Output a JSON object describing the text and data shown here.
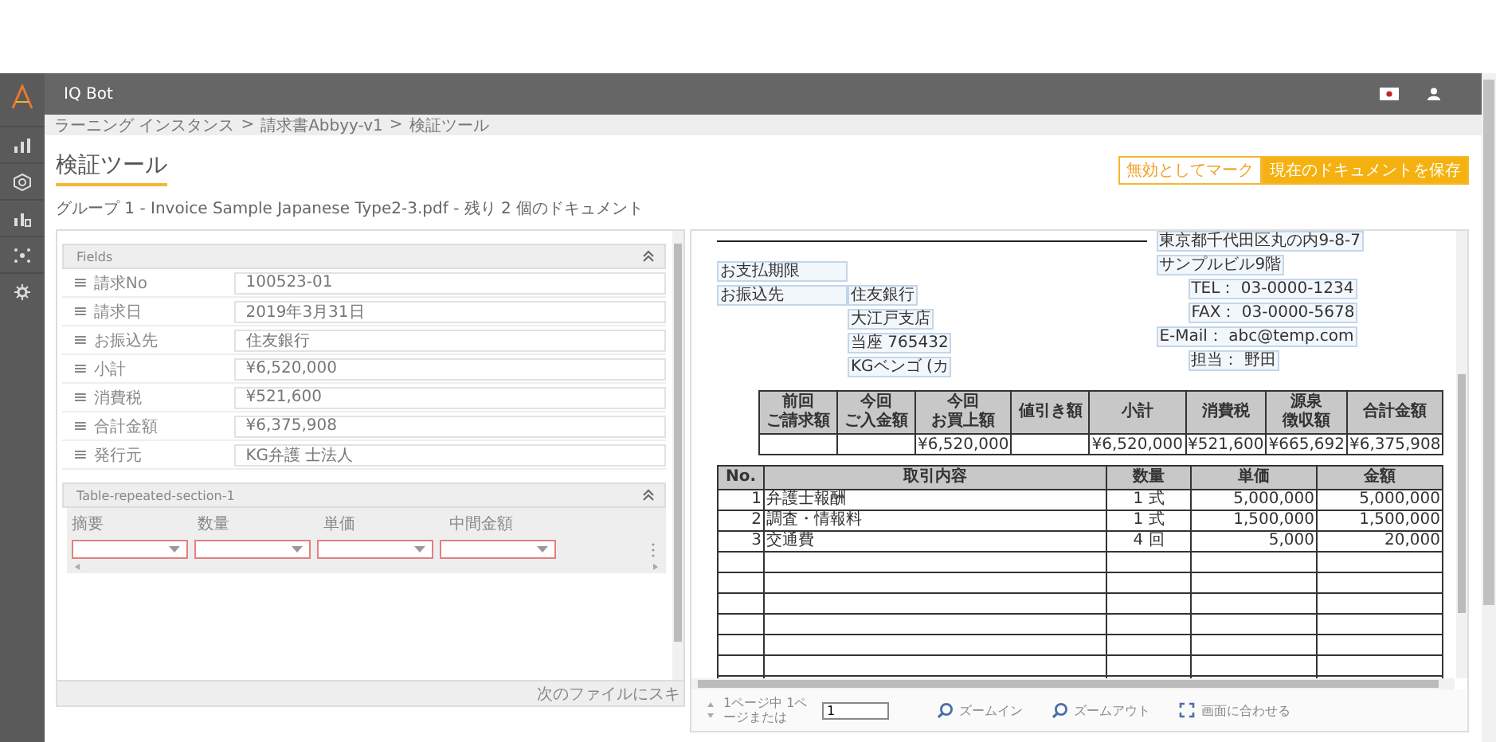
{
  "app": {
    "title": "IQ Bot"
  },
  "breadcrumb": {
    "separator": ">",
    "items": [
      "ラーニング インスタンス",
      "請求書Abbyy-v1",
      "検証ツール"
    ]
  },
  "page": {
    "title": "検証ツール",
    "subtitle": "グループ 1 - Invoice Sample Japanese Type2-3.pdf - 残り 2 個のドキュメント"
  },
  "actions": [
    {
      "label": "無効としてマーク",
      "kind": "outline"
    },
    {
      "label": "現在のドキュメントを保存",
      "kind": "primary"
    }
  ],
  "fields_panel": {
    "title": "Fields",
    "fields": [
      {
        "label": "請求No",
        "value": "100523-01"
      },
      {
        "label": "請求日",
        "value": "2019年3月31日"
      },
      {
        "label": "お振込先",
        "value": "住友銀行"
      },
      {
        "label": "小計",
        "value": "¥6,520,000"
      },
      {
        "label": "消費税",
        "value": "¥521,600"
      },
      {
        "label": "合計金額",
        "value": "¥6,375,908"
      },
      {
        "label": "発行元",
        "value": "KG弁護 士法人"
      }
    ]
  },
  "table_section": {
    "title": "Table-repeated-section-1",
    "columns": [
      {
        "label": "摘要",
        "invalid": true
      },
      {
        "label": "数量",
        "invalid": true
      },
      {
        "label": "単価",
        "invalid": true
      },
      {
        "label": "中間金額",
        "invalid": true
      }
    ]
  },
  "footer": {
    "skip_text": "次のファイルにスキ"
  },
  "viewer": {
    "document": {
      "sender_lines": [
        "東京都千代田区丸の内9-8-7",
        "サンプルビル9階",
        "TEL： 03-0000-1234",
        "FAX： 03-0000-5678",
        "E-Mail： abc@temp.com",
        "担当： 野田"
      ],
      "payment": [
        {
          "label": "お支払期限"
        },
        {
          "label": "お振込先",
          "lines": [
            "住友銀行",
            "大江戸支店",
            "当座 765432",
            "KGベンゴ (カ"
          ]
        }
      ],
      "summary": {
        "columns": [
          {
            "header": [
              "前回",
              "ご請求額"
            ]
          },
          {
            "header": [
              "今回",
              "ご入金額"
            ]
          },
          {
            "header": [
              "今回",
              "お買上額"
            ],
            "value": "¥6,520,000"
          },
          {
            "header": [
              "値引き額"
            ]
          },
          {
            "header": [
              "小計"
            ],
            "value": "¥6,520,000"
          },
          {
            "header": [
              "消費税"
            ],
            "value": "¥521,600"
          },
          {
            "header": [
              "源泉",
              "徴収額"
            ],
            "value": "¥665,692"
          },
          {
            "header": [
              "合計金額"
            ],
            "value": "¥6,375,908"
          }
        ]
      },
      "items": {
        "headers": [
          "No.",
          "取引内容",
          "数量",
          "単価",
          "金額"
        ],
        "rows": [
          [
            "1",
            "弁護士報酬",
            "1 式",
            "5,000,000",
            "5,000,000"
          ],
          [
            "2",
            "調査・情報料",
            "1 式",
            "1,500,000",
            "1,500,000"
          ],
          [
            "3",
            "交通費",
            "4 回",
            "5,000",
            "20,000"
          ]
        ]
      }
    },
    "pager": {
      "text": "1ページ中 1ページまたは",
      "page_value": "1"
    },
    "tools": [
      {
        "label": "ズームイン",
        "kind": "zoom-in"
      },
      {
        "label": "ズームアウト",
        "kind": "zoom-out"
      },
      {
        "label": "画面に合わせる",
        "kind": "fit"
      }
    ]
  }
}
